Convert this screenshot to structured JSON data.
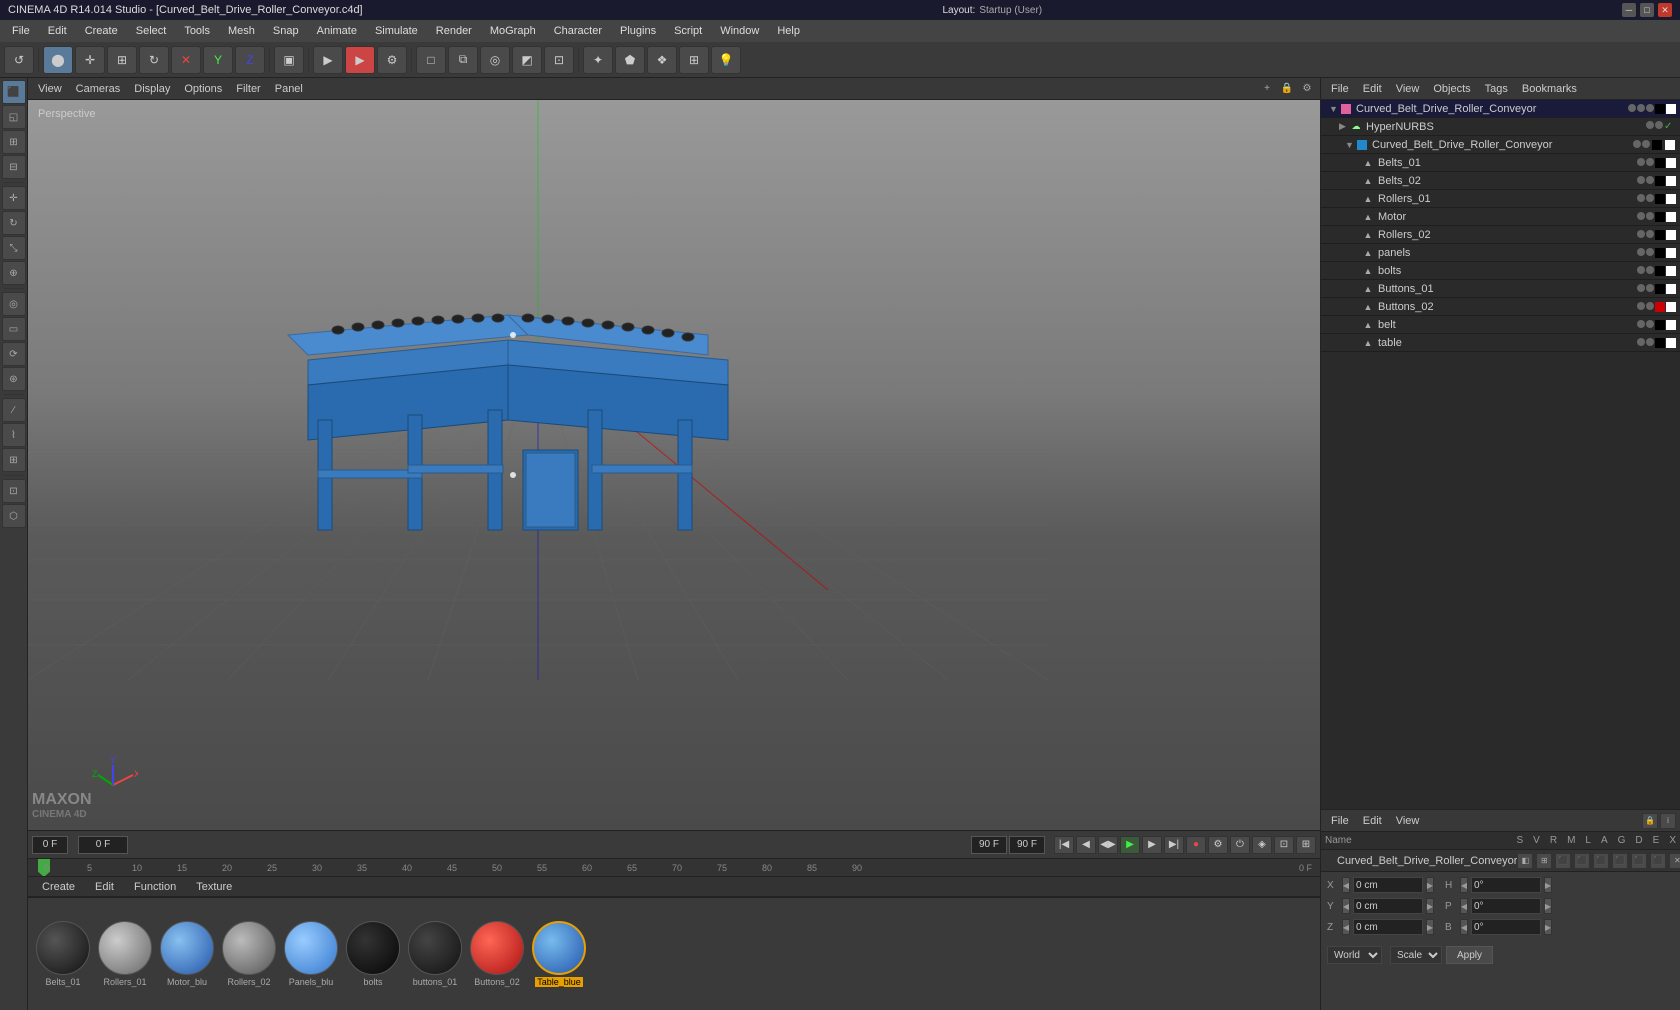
{
  "titlebar": {
    "title": "CINEMA 4D R14.014 Studio - [Curved_Belt_Drive_Roller_Conveyor.c4d]",
    "layout_label": "Layout:",
    "layout_value": "Startup (User)"
  },
  "menubar": {
    "items": [
      "File",
      "Edit",
      "Create",
      "Select",
      "Tools",
      "Mesh",
      "Snap",
      "Animate",
      "Simulate",
      "Render",
      "MoGraph",
      "Character",
      "Plugins",
      "Script",
      "Window",
      "Help"
    ]
  },
  "viewport": {
    "perspective_label": "Perspective",
    "menus": [
      "View",
      "Cameras",
      "Display",
      "Options",
      "Filter",
      "Panel"
    ]
  },
  "object_manager": {
    "menus": [
      "File",
      "Edit",
      "View",
      "Objects",
      "Tags",
      "Bookmarks"
    ],
    "root_name": "Curved_Belt_Drive_Roller_Conveyor",
    "hyper_nurbs": "HyperNURBS",
    "conveyor_name": "Curved_Belt_Drive_Roller_Conveyor",
    "objects": [
      {
        "name": "Belts_01",
        "indent": 3,
        "icon": "▲"
      },
      {
        "name": "Belts_02",
        "indent": 3,
        "icon": "▲"
      },
      {
        "name": "Rollers_01",
        "indent": 3,
        "icon": "▲"
      },
      {
        "name": "Motor",
        "indent": 3,
        "icon": "▲"
      },
      {
        "name": "Rollers_02",
        "indent": 3,
        "icon": "▲"
      },
      {
        "name": "panels",
        "indent": 3,
        "icon": "▲"
      },
      {
        "name": "bolts",
        "indent": 3,
        "icon": "▲"
      },
      {
        "name": "Buttons_01",
        "indent": 3,
        "icon": "▲"
      },
      {
        "name": "Buttons_02",
        "indent": 3,
        "icon": "▲"
      },
      {
        "name": "belt",
        "indent": 3,
        "icon": "▲"
      },
      {
        "name": "table",
        "indent": 3,
        "icon": "▲"
      }
    ]
  },
  "attributes": {
    "menus": [
      "File",
      "Edit",
      "View"
    ],
    "name_label": "Name",
    "object_name": "Curved_Belt_Drive_Roller_Conveyor",
    "fields": {
      "X_pos": "0 cm",
      "Y_pos": "0 cm",
      "Z_pos": "0 cm",
      "H_rot": "0°",
      "P_rot": "0°",
      "B_rot": "0°",
      "X_label": "X",
      "Y_label": "Y",
      "Z_label": "Z",
      "H_label": "H",
      "P_label": "P",
      "B_label": "B"
    },
    "coord_system": "World",
    "scale_label": "Scale",
    "apply_label": "Apply"
  },
  "materials": {
    "tabs": [
      "Create",
      "Edit",
      "Function",
      "Texture"
    ],
    "items": [
      {
        "name": "Belts_01",
        "color": "#222",
        "type": "dark",
        "selected": false
      },
      {
        "name": "Rollers_01",
        "color": "#888",
        "type": "metal",
        "selected": false
      },
      {
        "name": "Motor_blu",
        "color": "#4488cc",
        "type": "blue",
        "selected": false
      },
      {
        "name": "Rollers_02",
        "color": "#888",
        "type": "metal2",
        "selected": false
      },
      {
        "name": "Panels_blu",
        "color": "#5599dd",
        "type": "blue2",
        "selected": false
      },
      {
        "name": "bolts",
        "color": "#111",
        "type": "black",
        "selected": false
      },
      {
        "name": "buttons_01",
        "color": "#222",
        "type": "darkball",
        "selected": false
      },
      {
        "name": "Buttons_02",
        "color": "#cc2222",
        "type": "red",
        "selected": false
      },
      {
        "name": "Table_blue",
        "color": "#4488cc",
        "type": "blue3",
        "selected": true
      }
    ]
  },
  "timeline": {
    "frame_start": "0 F",
    "frame_end": "90 F",
    "current_frame": "0 F",
    "ruler_ticks": [
      "0",
      "5",
      "10",
      "15",
      "20",
      "25",
      "30",
      "35",
      "40",
      "45",
      "50",
      "55",
      "60",
      "65",
      "70",
      "75",
      "80",
      "85",
      "90"
    ]
  }
}
